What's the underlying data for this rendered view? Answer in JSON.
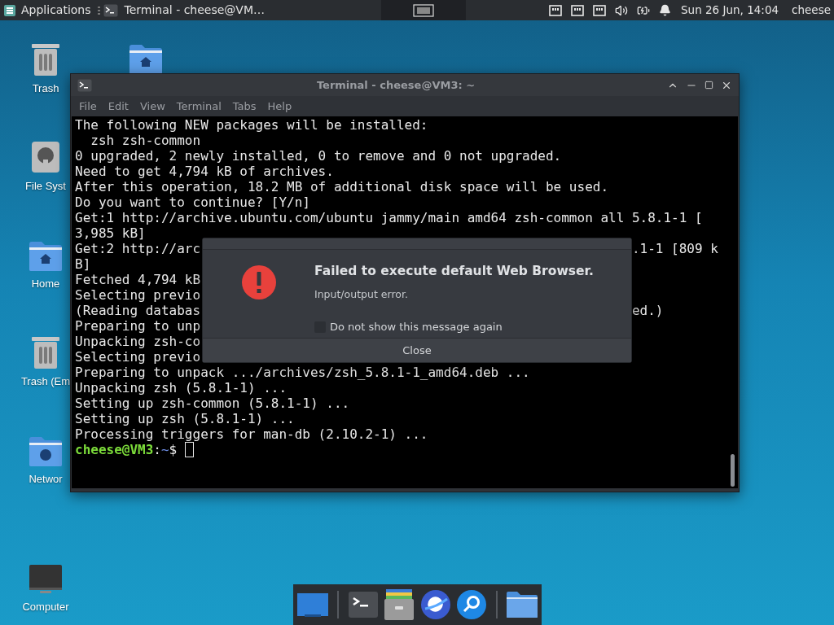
{
  "top_panel": {
    "applications": "Applications",
    "task": "Terminal - cheese@VM…",
    "clock": "Sun 26 Jun, 14:04",
    "user": "cheese"
  },
  "desktop_icons": [
    {
      "kind": "trash",
      "label": "Trash"
    },
    {
      "kind": "drive",
      "label": "File Syst"
    },
    {
      "kind": "home",
      "label": "Home"
    },
    {
      "kind": "trash",
      "label": "Trash (Em"
    },
    {
      "kind": "network",
      "label": "Networ"
    },
    {
      "kind": "computer",
      "label": "Computer"
    }
  ],
  "desktop_icons_column_2": [
    {
      "kind": "home"
    }
  ],
  "terminal": {
    "title": "Terminal - cheese@VM3: ~",
    "menu": [
      "File",
      "Edit",
      "View",
      "Terminal",
      "Tabs",
      "Help"
    ],
    "lines": [
      {
        "kind": "output",
        "text": "The following NEW packages will be installed:"
      },
      {
        "kind": "output",
        "text": "  zsh zsh-common"
      },
      {
        "kind": "output",
        "text": "0 upgraded, 2 newly installed, 0 to remove and 0 not upgraded."
      },
      {
        "kind": "output",
        "text": "Need to get 4,794 kB of archives."
      },
      {
        "kind": "output",
        "text": "After this operation, 18.2 MB of additional disk space will be used."
      },
      {
        "kind": "output",
        "text": "Do you want to continue? [Y/n]"
      },
      {
        "kind": "output",
        "text": "Get:1 http://archive.ubuntu.com/ubuntu jammy/main amd64 zsh-common all 5.8.1-1 ["
      },
      {
        "kind": "output",
        "text": "3,985 kB]"
      },
      {
        "kind": "output",
        "text": "Get:2 http://arc",
        "tail": ".1-1 [809 k"
      },
      {
        "kind": "output",
        "text": "B]"
      },
      {
        "kind": "output",
        "text": "Fetched 4,794 kB"
      },
      {
        "kind": "output",
        "text": "Selecting previo"
      },
      {
        "kind": "output",
        "text": "(Reading databas",
        "tail": "ed.)"
      },
      {
        "kind": "output",
        "text": "Preparing to unp"
      },
      {
        "kind": "output",
        "text": "Unpacking zsh-co"
      },
      {
        "kind": "output",
        "text": "Selecting previo"
      },
      {
        "kind": "output",
        "text": "Preparing to unpack .../archives/zsh_5.8.1-1_amd64.deb ..."
      },
      {
        "kind": "output",
        "text": "Unpacking zsh (5.8.1-1) ..."
      },
      {
        "kind": "output",
        "text": "Setting up zsh-common (5.8.1-1) ..."
      },
      {
        "kind": "output",
        "text": "Setting up zsh (5.8.1-1) ..."
      },
      {
        "kind": "output",
        "text": "Processing triggers for man-db (2.10.2-1) ..."
      },
      {
        "kind": "prompt",
        "user": "cheese@VM3",
        "separator": ":",
        "path": "~",
        "symbol": "$"
      }
    ]
  },
  "dialog": {
    "title": "Failed to execute default Web Browser.",
    "message": "Input/output error.",
    "checkbox": {
      "label": "Do not show this message again",
      "checked": false
    },
    "button": "Close"
  },
  "dock": [
    {
      "kind": "desktop"
    },
    {
      "kind": "separator"
    },
    {
      "kind": "terminal"
    },
    {
      "kind": "files"
    },
    {
      "kind": "browser"
    },
    {
      "kind": "search"
    },
    {
      "kind": "separator"
    },
    {
      "kind": "folder"
    }
  ]
}
